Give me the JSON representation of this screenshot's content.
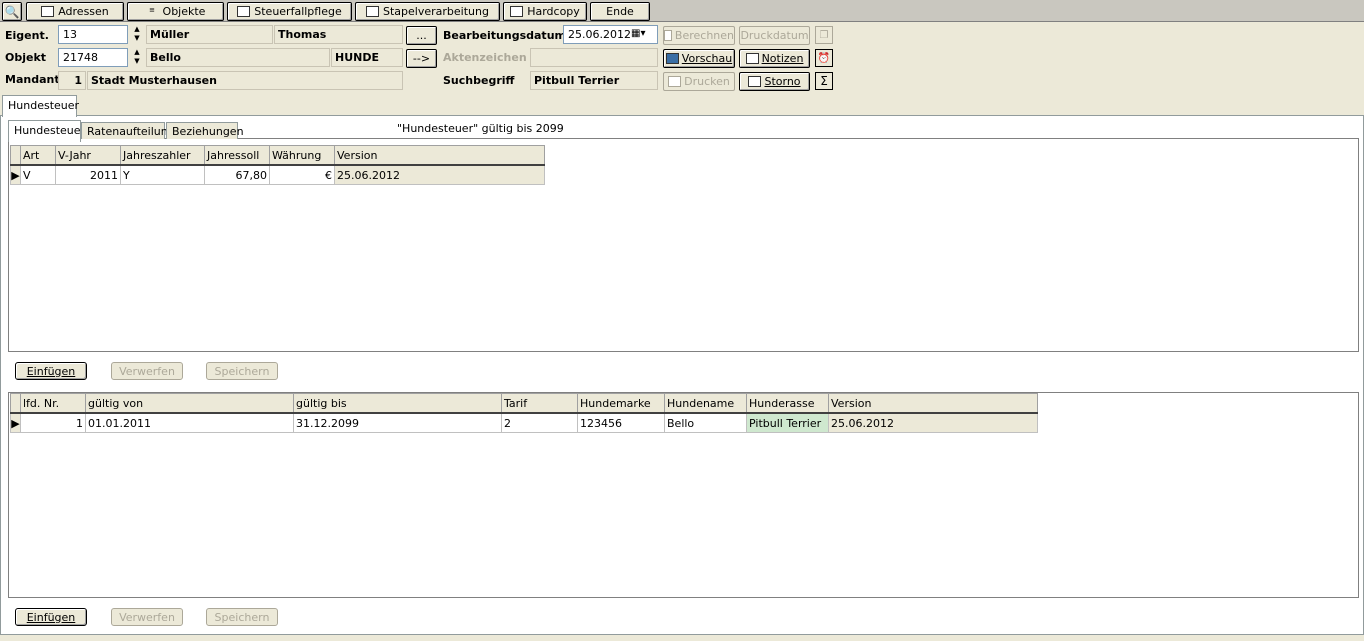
{
  "toolbar": {
    "buttons": [
      {
        "label": "Adressen",
        "icon": "card-icon"
      },
      {
        "label": "Objekte",
        "icon": "tree-icon"
      },
      {
        "label": "Steuerfallpflege",
        "icon": "form-icon"
      },
      {
        "label": "Stapelverarbeitung",
        "icon": "stack-icon"
      },
      {
        "label": "Hardcopy",
        "icon": "printer-icon"
      },
      {
        "label": "Ende",
        "icon": ""
      }
    ]
  },
  "header": {
    "eigent_label": "Eigent.",
    "eigent_value": "13",
    "eigent_name": "Müller",
    "eigent_first": "Thomas",
    "objekt_label": "Objekt",
    "objekt_value": "21748",
    "objekt_name": "Bello",
    "objekt_type": "HUNDE",
    "mandant_label": "Mandant",
    "mandant_value": "1",
    "mandant_name": "Stadt Musterhausen",
    "dots_label": "...",
    "arrow_label": "-->",
    "bearb_label": "Bearbeitungsdatum",
    "bearb_value": "25.06.2012",
    "akten_label": "Aktenzeichen",
    "akten_value": "",
    "such_label": "Suchbegriff",
    "such_value": "Pitbull Terrier",
    "berechnen": "Berechnen",
    "druckdatum": "Druckdatum",
    "vorschau": "Vorschau",
    "notizen": "Notizen",
    "drucken": "Drucken",
    "storno": "Storno",
    "sigma": "Σ"
  },
  "outer_tab": "Hundesteuer",
  "inner_tabs": [
    "Hundesteuer",
    "Ratenaufteilung",
    "Beziehungen"
  ],
  "validity_note": "\"Hundesteuer\" gültig bis 2099",
  "grid1": {
    "columns": [
      "Art",
      "V-Jahr",
      "Jahreszahler",
      "Jahressoll",
      "Währung",
      "Version"
    ],
    "rows": [
      [
        "V",
        "2011",
        "Y",
        "67,80",
        "€",
        "25.06.2012"
      ]
    ]
  },
  "grid2": {
    "columns": [
      "lfd. Nr.",
      "gültig von",
      "gültig bis",
      "Tarif",
      "Hundemarke",
      "Hundename",
      "Hunderasse",
      "Version"
    ],
    "rows": [
      [
        "1",
        "01.01.2011",
        "31.12.2099",
        "2",
        "123456",
        "Bello",
        "Pitbull Terrier",
        "25.06.2012"
      ]
    ]
  },
  "actions": {
    "einfuegen": "Einfügen",
    "verwerfen": "Verwerfen",
    "speichern": "Speichern"
  },
  "colors": {
    "highlight": "#cfe8cf",
    "disabled": "#aca899"
  }
}
